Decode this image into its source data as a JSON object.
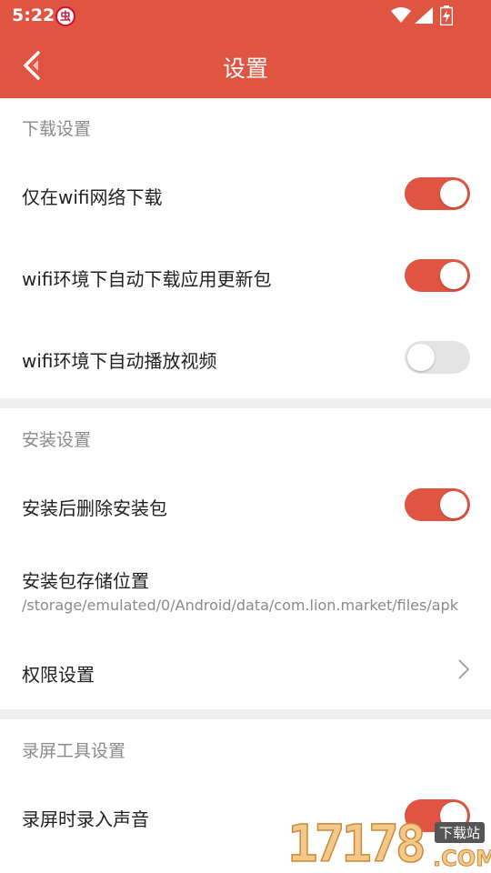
{
  "status_bar": {
    "time": "5:22",
    "app_badge": "虫"
  },
  "app_bar": {
    "title": "设置"
  },
  "sections": [
    {
      "header": "下载设置",
      "rows": [
        {
          "label": "仅在wifi网络下载",
          "toggle_on": true
        },
        {
          "label": "wifi环境下自动下载应用更新包",
          "toggle_on": true
        },
        {
          "label": "wifi环境下自动播放视频",
          "toggle_on": false
        }
      ]
    },
    {
      "header": "安装设置",
      "rows": [
        {
          "label": "安装后删除安装包",
          "toggle_on": true
        },
        {
          "label": "安装包存储位置",
          "subtitle": "/storage/emulated/0/Android/data/com.lion.market/files/apk"
        },
        {
          "label": "权限设置",
          "chevron": true
        }
      ]
    },
    {
      "header": "录屏工具设置",
      "rows": [
        {
          "label": "录屏时录入声音",
          "toggle_on": true
        }
      ]
    }
  ],
  "watermark": {
    "digits": "17178",
    "tag": "下载站",
    "domain": ".COM"
  },
  "colors": {
    "accent": "#e05442",
    "toggle_off": "#e4e4e4",
    "section_header": "#8a8a8a",
    "divider": "#eeeeee"
  }
}
